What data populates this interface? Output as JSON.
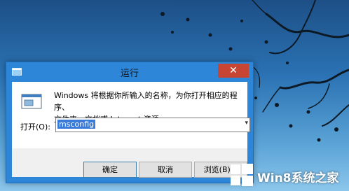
{
  "dialog": {
    "title": "运行",
    "close_glyph": "✕",
    "description_line1": "Windows 将根据你所输入的名称，为你打开相应的程序、",
    "description_line2": "文件夹、文档或 Internet 资源。",
    "open_label": "打开(O):",
    "command_value": "msconfig",
    "dropdown_glyph": "▾",
    "buttons": {
      "ok": "确定",
      "cancel": "取消",
      "browse": "浏览(B)..."
    }
  },
  "watermark": {
    "text": "Win8系统之家"
  },
  "colors": {
    "titlebar": "#2d86d8",
    "close": "#c84533",
    "selection": "#3a7ad9"
  }
}
